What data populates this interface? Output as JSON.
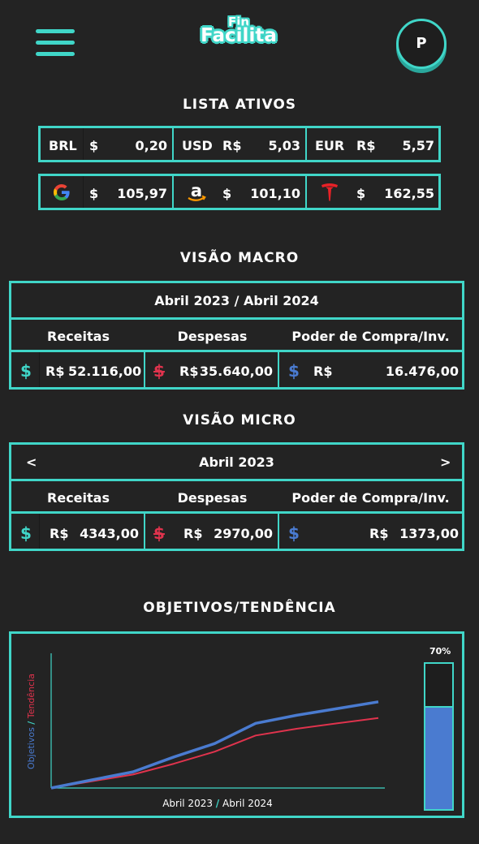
{
  "header": {
    "logo_top": "Fin",
    "logo_bottom": "Facilita",
    "avatar_letter": "P"
  },
  "assets": {
    "title": "LISTA ATIVOS",
    "currencies": [
      {
        "code": "BRL",
        "symbol": "$",
        "value": "0,20"
      },
      {
        "code": "USD",
        "symbol": "R$",
        "value": "5,03"
      },
      {
        "code": "EUR",
        "symbol": "R$",
        "value": "5,57"
      }
    ],
    "stocks": [
      {
        "icon": "google-icon",
        "symbol": "$",
        "value": "105,97"
      },
      {
        "icon": "amazon-icon",
        "symbol": "$",
        "value": "101,10"
      },
      {
        "icon": "tesla-icon",
        "symbol": "$",
        "value": "162,55"
      }
    ]
  },
  "macro": {
    "title": "VISÃO MACRO",
    "period": "Abril 2023 / Abril 2024",
    "col_income": "Receitas",
    "col_expense": "Despesas",
    "col_power": "Poder de Compra/Inv.",
    "currency": "R$",
    "income": "52.116,00",
    "expense": "35.640,00",
    "power": "16.476,00"
  },
  "micro": {
    "title": "VISÃO MICRO",
    "prev": "<",
    "next": ">",
    "period": "Abril 2023",
    "col_income": "Receitas",
    "col_expense": "Despesas",
    "col_power": "Poder de Compra/Inv.",
    "currency": "R$",
    "income": "4343,00",
    "expense": "2970,00",
    "power": "1373,00"
  },
  "objectives": {
    "title": "OBJETIVOS/TENDÊNCIA",
    "progress_label": "70%",
    "progress_fraction": 0.7,
    "colors": {
      "accent": "#40d6c8",
      "objetivos": "#4a7bd0",
      "tendencia": "#e0334d"
    }
  },
  "chart_data": {
    "type": "line",
    "xlabel_part1": "Abril 2023",
    "xlabel_sep": "/",
    "xlabel_part2": "Abril 2024",
    "ylabel_part1": "Objetivos",
    "ylabel_sep": "/",
    "ylabel_part2": "Tendência",
    "ylim": [
      0,
      100
    ],
    "series": [
      {
        "name": "Objetivos",
        "color": "#4a7bd0",
        "values": [
          0,
          6,
          12,
          23,
          33,
          48,
          54,
          59,
          64
        ]
      },
      {
        "name": "Tendência",
        "color": "#e0334d",
        "values": [
          0,
          5,
          10,
          18,
          27,
          39,
          44,
          48,
          52
        ]
      }
    ]
  }
}
